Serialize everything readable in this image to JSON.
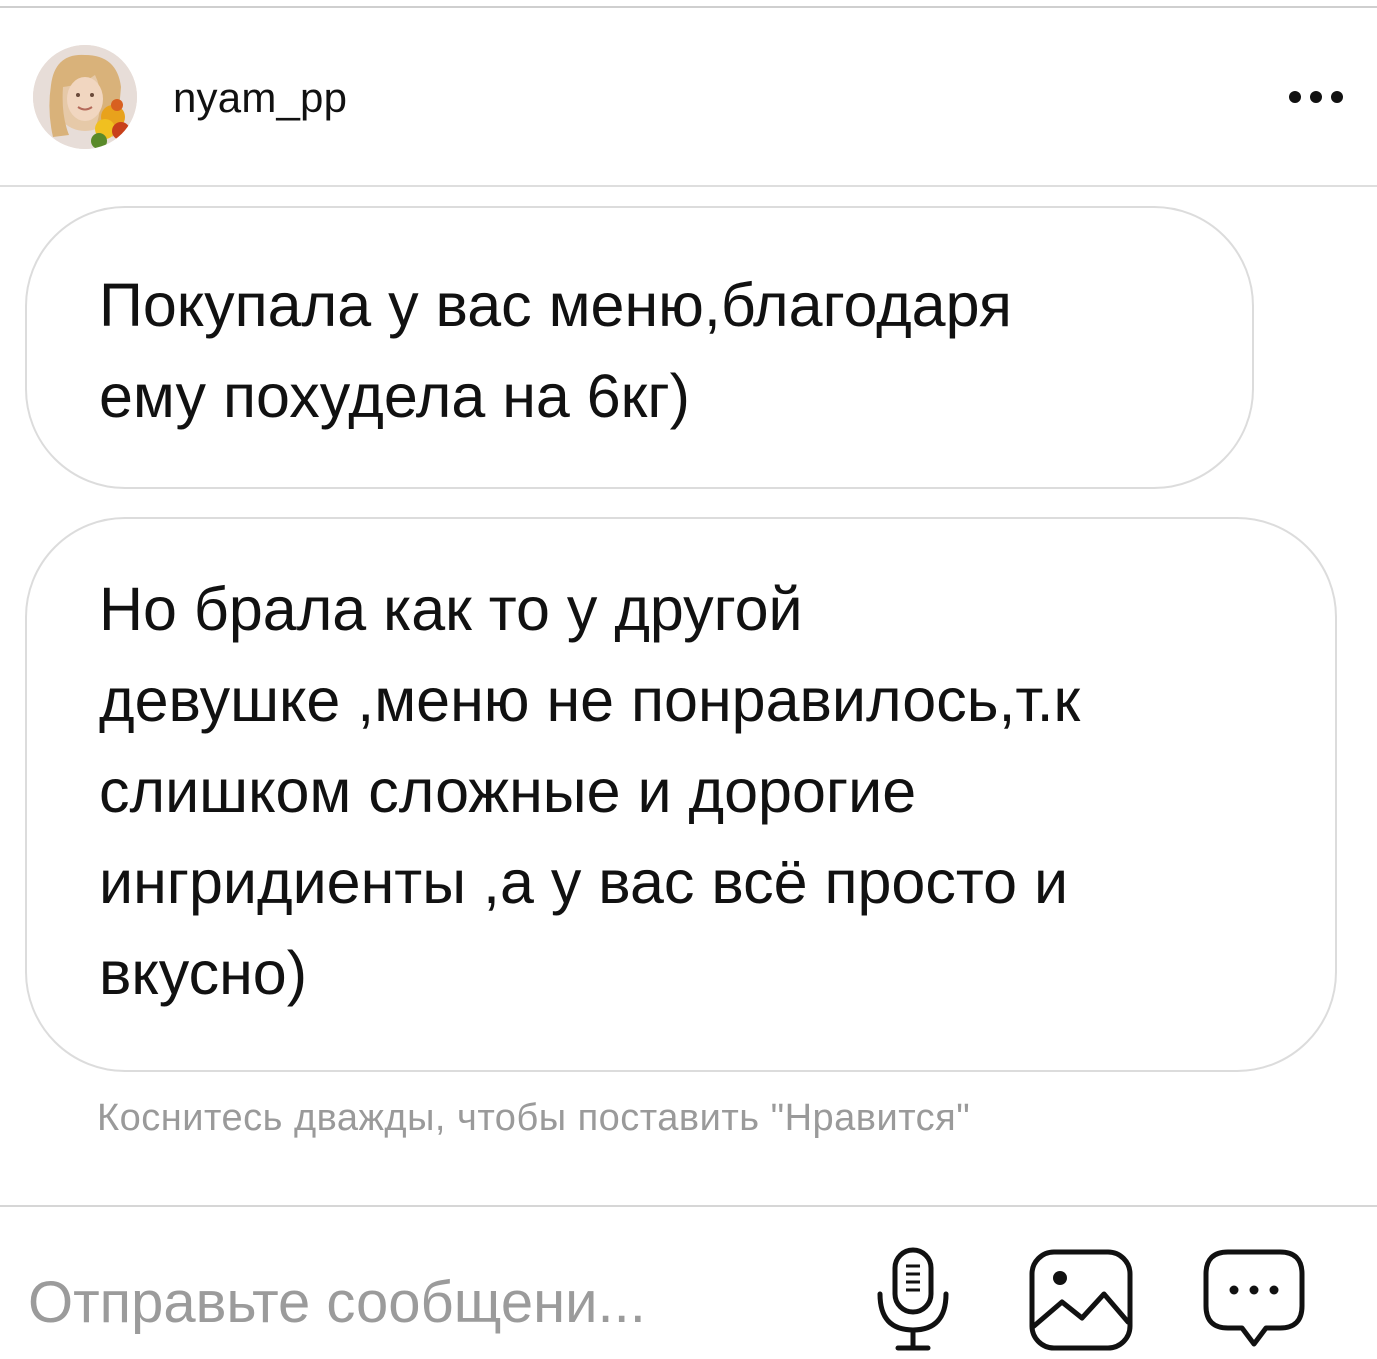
{
  "header": {
    "username": "nyam_pp",
    "avatar_icon": "user-avatar",
    "more_icon": "more-horizontal-icon"
  },
  "messages": [
    {
      "lines": [
        "Покупала у вас меню,благодаря",
        "ему похудела на 6кг)"
      ]
    },
    {
      "lines": [
        "Но брала как то у другой",
        "девушке ,меню не понравилось,т.к",
        "слишком сложные и дорогие",
        "ингридиенты ,а у вас всё просто и",
        "вкусно)"
      ]
    }
  ],
  "hint": "Коснитесь дважды, чтобы поставить \"Нравится\"",
  "composer": {
    "placeholder": "Отправьте сообщени...",
    "value": "",
    "mic_icon": "microphone-icon",
    "photo_icon": "image-icon",
    "sticker_icon": "chat-bubble-icon"
  },
  "colors": {
    "text": "#111111",
    "hint": "#9a9a9a",
    "border": "#dcdcdc",
    "background": "#ffffff"
  }
}
